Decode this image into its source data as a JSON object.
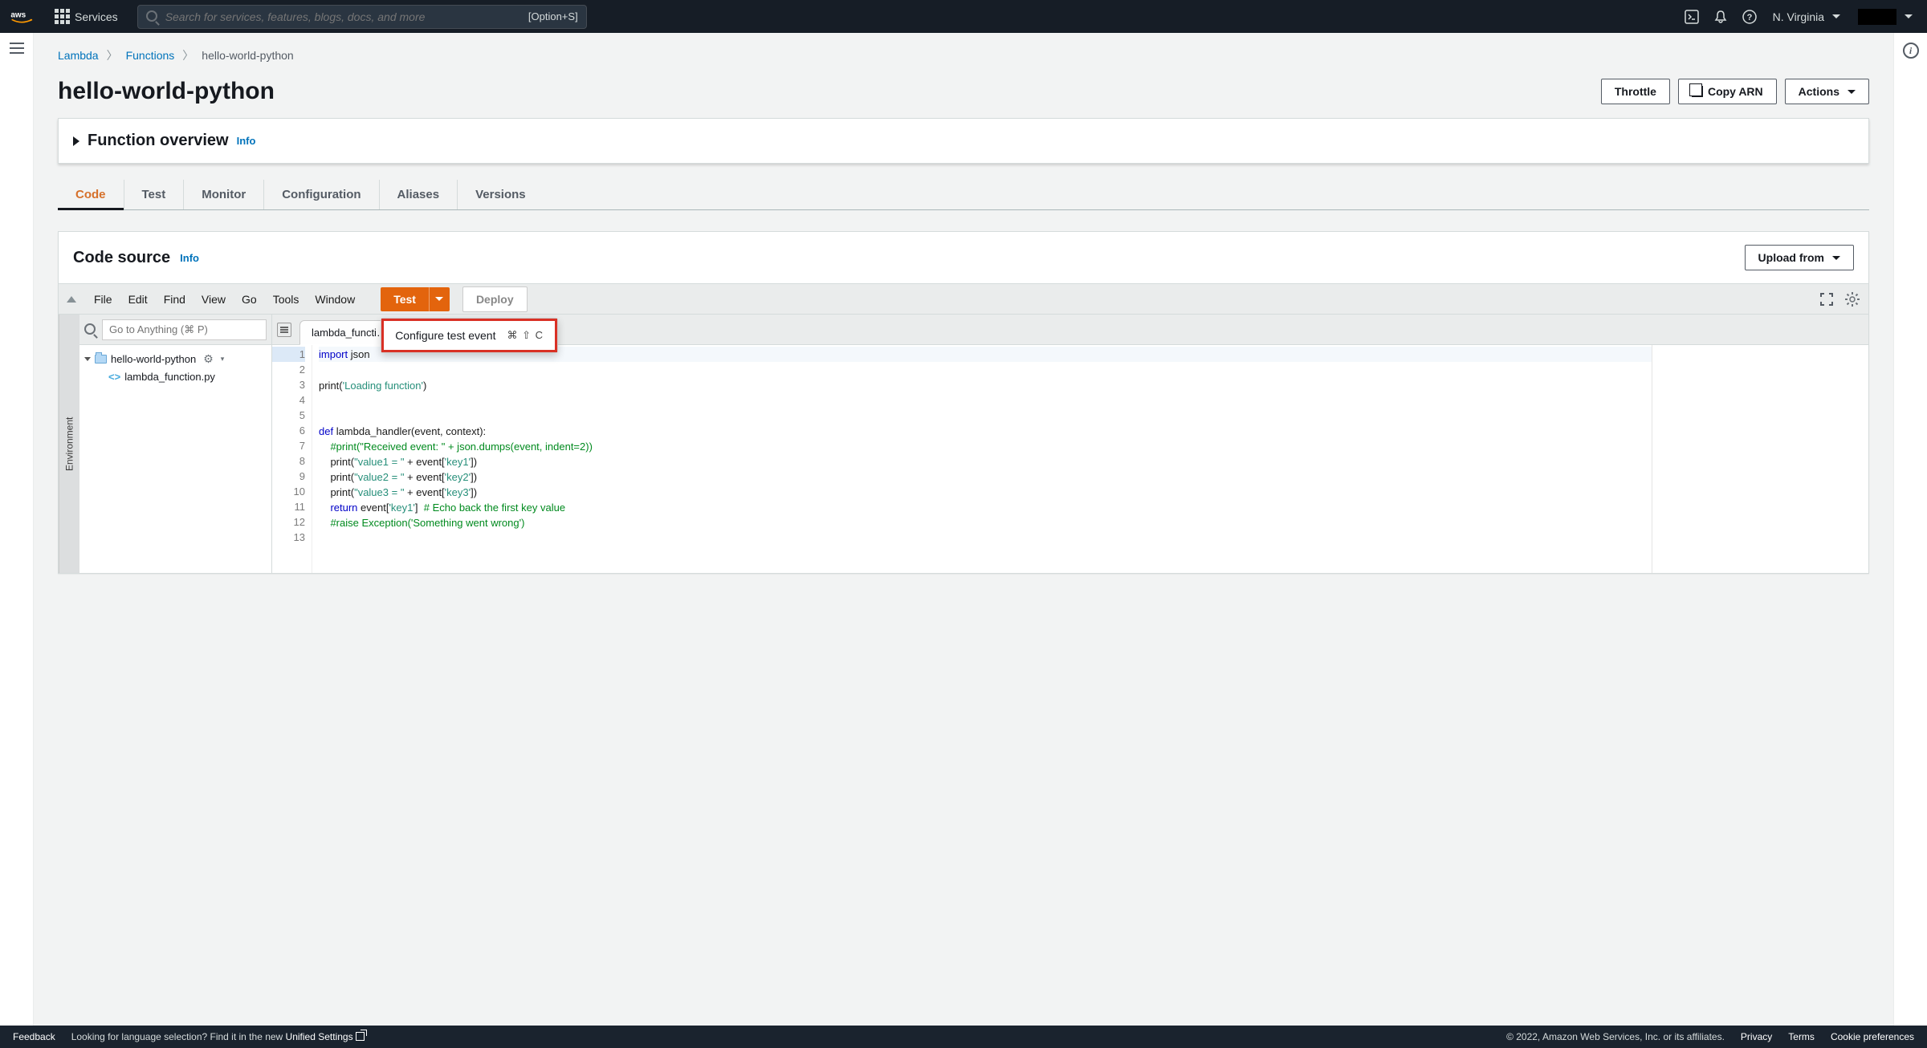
{
  "topnav": {
    "services": "Services",
    "search_placeholder": "Search for services, features, blogs, docs, and more",
    "search_hint": "[Option+S]",
    "region": "N. Virginia"
  },
  "breadcrumb": {
    "items": [
      "Lambda",
      "Functions"
    ],
    "current": "hello-world-python"
  },
  "title": "hello-world-python",
  "title_actions": {
    "throttle": "Throttle",
    "copy_arn": "Copy ARN",
    "actions": "Actions"
  },
  "overview": {
    "heading": "Function overview",
    "info": "Info"
  },
  "tabs": [
    "Code",
    "Test",
    "Monitor",
    "Configuration",
    "Aliases",
    "Versions"
  ],
  "active_tab": 0,
  "codesrc": {
    "heading": "Code source",
    "info": "Info",
    "upload": "Upload from"
  },
  "ide": {
    "menus": [
      "File",
      "Edit",
      "Find",
      "View",
      "Go",
      "Tools",
      "Window"
    ],
    "test": "Test",
    "deploy": "Deploy",
    "popup_label": "Configure test event",
    "popup_kbd": "⌘ ⇧ C",
    "env_label": "Environment",
    "goto_placeholder": "Go to Anything (⌘ P)",
    "tree_folder": "hello-world-python",
    "tree_file": "lambda_function.py",
    "file_tab": "lambda_functi…",
    "code_lines": [
      {
        "n": 1,
        "segs": [
          {
            "t": "import",
            "c": "k-blue"
          },
          {
            "t": " json",
            "c": "k-black"
          }
        ]
      },
      {
        "n": 2,
        "segs": []
      },
      {
        "n": 3,
        "segs": [
          {
            "t": "print(",
            "c": "k-black"
          },
          {
            "t": "'Loading function'",
            "c": "k-teal"
          },
          {
            "t": ")",
            "c": "k-black"
          }
        ]
      },
      {
        "n": 4,
        "segs": []
      },
      {
        "n": 5,
        "segs": []
      },
      {
        "n": 6,
        "segs": [
          {
            "t": "def",
            "c": "k-blue"
          },
          {
            "t": " lambda_handler(event, context):",
            "c": "k-black"
          }
        ]
      },
      {
        "n": 7,
        "segs": [
          {
            "t": "    ",
            "c": ""
          },
          {
            "t": "#print(\"Received event: \" + json.dumps(event, indent=2))",
            "c": "k-green"
          }
        ]
      },
      {
        "n": 8,
        "segs": [
          {
            "t": "    print(",
            "c": "k-black"
          },
          {
            "t": "\"value1 = \"",
            "c": "k-teal"
          },
          {
            "t": " + event[",
            "c": "k-black"
          },
          {
            "t": "'key1'",
            "c": "k-teal"
          },
          {
            "t": "])",
            "c": "k-black"
          }
        ]
      },
      {
        "n": 9,
        "segs": [
          {
            "t": "    print(",
            "c": "k-black"
          },
          {
            "t": "\"value2 = \"",
            "c": "k-teal"
          },
          {
            "t": " + event[",
            "c": "k-black"
          },
          {
            "t": "'key2'",
            "c": "k-teal"
          },
          {
            "t": "])",
            "c": "k-black"
          }
        ]
      },
      {
        "n": 10,
        "segs": [
          {
            "t": "    print(",
            "c": "k-black"
          },
          {
            "t": "\"value3 = \"",
            "c": "k-teal"
          },
          {
            "t": " + event[",
            "c": "k-black"
          },
          {
            "t": "'key3'",
            "c": "k-teal"
          },
          {
            "t": "])",
            "c": "k-black"
          }
        ]
      },
      {
        "n": 11,
        "segs": [
          {
            "t": "    ",
            "c": ""
          },
          {
            "t": "return",
            "c": "k-blue"
          },
          {
            "t": " event[",
            "c": "k-black"
          },
          {
            "t": "'key1'",
            "c": "k-teal"
          },
          {
            "t": "]  ",
            "c": "k-black"
          },
          {
            "t": "# Echo back the first key value",
            "c": "k-green"
          }
        ]
      },
      {
        "n": 12,
        "segs": [
          {
            "t": "    ",
            "c": ""
          },
          {
            "t": "#raise Exception('Something went wrong')",
            "c": "k-green"
          }
        ]
      },
      {
        "n": 13,
        "segs": []
      }
    ]
  },
  "footer": {
    "feedback": "Feedback",
    "lang_hint": "Looking for language selection? Find it in the new ",
    "unified": "Unified Settings",
    "copyright": "© 2022, Amazon Web Services, Inc. or its affiliates.",
    "privacy": "Privacy",
    "terms": "Terms",
    "cookies": "Cookie preferences"
  }
}
